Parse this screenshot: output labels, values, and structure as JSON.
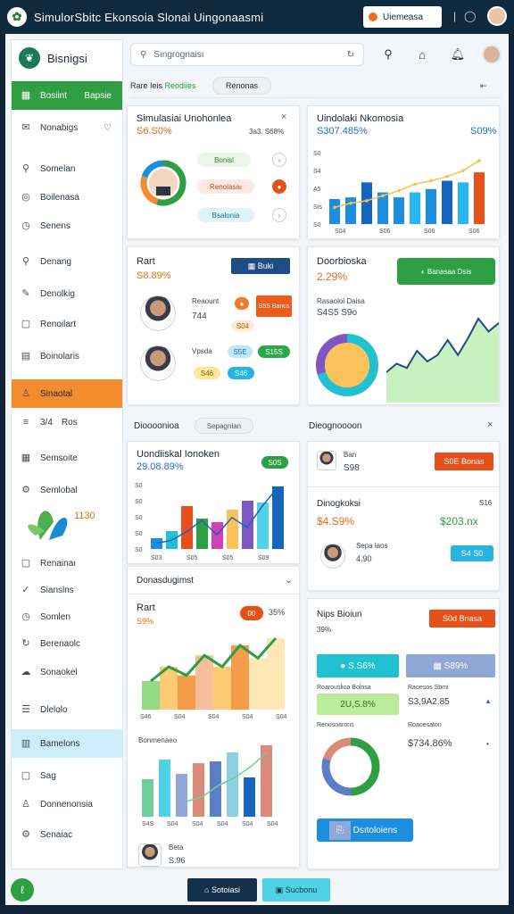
{
  "app": {
    "title": "SimulorSbitc Ekonsoia Slonai Uingonaasmi",
    "top_button": "Uiemeasa"
  },
  "sidebar": {
    "brand": "Bisnigsi",
    "items": [
      {
        "label": "Bosiint",
        "extra": "Bapsie",
        "icon": "chart-icon"
      },
      {
        "label": "Nonabigs",
        "icon": "mail-icon"
      },
      {
        "label": "Somelan",
        "icon": "search-icon"
      },
      {
        "label": "Boilenasa",
        "icon": "globe-icon"
      },
      {
        "label": "Senens",
        "icon": "clock-icon"
      },
      {
        "label": "Denang",
        "icon": "search-icon"
      },
      {
        "label": "Denolkig",
        "icon": "pencil-icon"
      },
      {
        "label": "Renoilart",
        "icon": "box-icon"
      },
      {
        "label": "Boinolaris",
        "icon": "calendar-icon"
      },
      {
        "label": "Sinaotal",
        "icon": "user-icon"
      },
      {
        "label": "Ros",
        "prefix": "3/4",
        "icon": "list-icon"
      },
      {
        "label": "Semsoite",
        "icon": "chart-icon"
      },
      {
        "label": "Semlobal",
        "icon": "settings-icon"
      },
      {
        "label": "Renainaı",
        "icon": "box-icon"
      },
      {
        "label": "Sianslns",
        "icon": "check-icon"
      },
      {
        "label": "Somlen",
        "icon": "clock-icon"
      },
      {
        "label": "Berenaolc",
        "icon": "sync-icon"
      },
      {
        "label": "Sonaokel",
        "icon": "cloud-icon"
      },
      {
        "label": "Dlelolo",
        "icon": "menu-icon"
      },
      {
        "label": "Bamelons",
        "icon": "table-icon"
      },
      {
        "label": "Sag",
        "icon": "box-icon"
      },
      {
        "label": "Donnenonsia",
        "icon": "user-icon"
      },
      {
        "label": "Senaiac",
        "icon": "settings-icon"
      }
    ],
    "promo_text": "1130"
  },
  "search": {
    "placeholder": "Sıngrognaisı"
  },
  "tabs": {
    "label": "Rare Ieis",
    "active": "Reodiies",
    "second": "Renonas"
  },
  "card1": {
    "title": "Simulasiai Unohonlea",
    "value": "S6.S0%",
    "side": "3a3. S68%",
    "rows": [
      {
        "label": "Bonisl"
      },
      {
        "label": "Renolasaı"
      },
      {
        "label": "Bsalonia"
      }
    ],
    "donut": [
      55,
      25,
      20
    ]
  },
  "card2": {
    "title": "Uindolaki Nkomosia",
    "value": "S307.485%",
    "side": "S09%",
    "chart_data": {
      "type": "bar",
      "categories": [
        "S04",
        "S06",
        "S06",
        "S06"
      ],
      "series": [
        {
          "values": [
            30,
            32,
            50,
            38,
            32,
            38,
            42,
            52,
            50,
            62
          ]
        },
        {
          "values": [
            20,
            25,
            28,
            34,
            40,
            48,
            52,
            57,
            64,
            76
          ]
        }
      ],
      "ylim": [
        0,
        90
      ],
      "ticks": [
        "S0",
        "Sts",
        "A5",
        "S4",
        "S0"
      ]
    }
  },
  "card3": {
    "title": "Rart",
    "value": "S8.89%",
    "button": "Buki",
    "person1": {
      "name": "Reaount",
      "value": "744",
      "b1": "S5S Bancs",
      "b2": "S04"
    },
    "person2": {
      "name": "Vpsda",
      "b1": "S5E",
      "b2": "S15S",
      "b3": "S46"
    }
  },
  "card4": {
    "title": "Doorbioska",
    "value": "2.29%",
    "button": "Banasaa Dsis",
    "sub": "Rasaoloi Daisa",
    "sub_value": "S4S5 S9o",
    "line": [
      20,
      28,
      24,
      40,
      30,
      36,
      50,
      36,
      52,
      70,
      58,
      66
    ],
    "donut": [
      70,
      30
    ]
  },
  "section2": {
    "left": "Dioooonioa",
    "chip": "Sepagnian",
    "right": "Dieognoooon"
  },
  "card5": {
    "title": "Uondiiskal Ionoken",
    "value": "29.08.89%",
    "badge": "S0S",
    "chart_data": {
      "type": "bar",
      "categories": [
        "S03",
        "S05",
        "S05",
        "S09"
      ],
      "values": [
        12,
        20,
        48,
        34,
        30,
        44,
        54,
        52,
        70
      ],
      "line": [
        8,
        12,
        24,
        40,
        20,
        44,
        30,
        60,
        86
      ],
      "ticks": [
        "S0",
        "S0",
        "S0",
        "S0",
        "S0"
      ]
    }
  },
  "card6": {
    "name": "Ban",
    "value": "S98",
    "button": "S0E Bonas",
    "title": "Dinogkoksi",
    "big": "$4.S9%",
    "small_label": "S16",
    "big2": "$203.nx",
    "row": {
      "name": "Sepa laos",
      "value": "4.90",
      "badge": "S4 S0"
    }
  },
  "card7": {
    "title": "Donasdugimst",
    "label": "Rart",
    "value": "S9%",
    "badge_num": "00",
    "badge_pct": "35%",
    "area": [
      40,
      60,
      48,
      76,
      60,
      90,
      72,
      100
    ],
    "sub": "Bonmenaeo",
    "bars": [
      42,
      64,
      48,
      60,
      62,
      72,
      44,
      80
    ],
    "line2": [
      10,
      18,
      36,
      48,
      66,
      88
    ],
    "ticks": [
      "S4S",
      "S04",
      "S04",
      "S04",
      "S04",
      "S04"
    ],
    "person": {
      "name": "Beta",
      "value": "S.96"
    }
  },
  "card8": {
    "title": "Nips Bioiun",
    "value": "39%",
    "button": "S0d Bnasa",
    "b1": "S.S6%",
    "b2": "S89%",
    "l1": "Roarouslioa Bolnsa",
    "v1": "2U,S.8%",
    "l2": "Raoesos Sbmi",
    "v2": "S3,9A2.85",
    "l3": "Renosoarons",
    "l4": "Roaoesaton",
    "v4": "$734.86%",
    "donut": [
      50,
      30,
      20
    ],
    "footer": "Dsıtoloiens"
  },
  "bottom": {
    "btn1": "Sotoiasi",
    "btn2": "Sucbonu"
  },
  "colors": {
    "accent_green": "#2ea043",
    "accent_orange": "#f28c2c",
    "blue": "#1f6fd6",
    "dark": "#0f2a3f"
  }
}
